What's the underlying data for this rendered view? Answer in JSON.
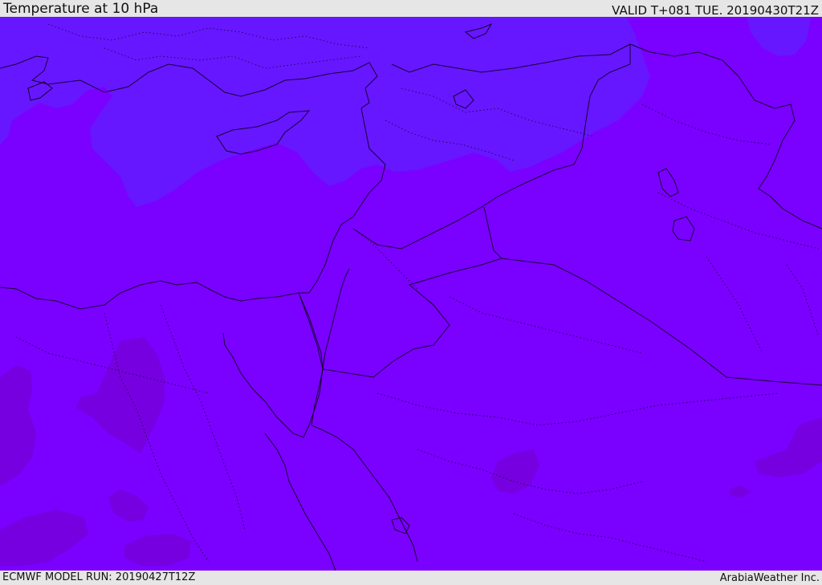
{
  "header": {
    "title": "Temperature at 10 hPa",
    "valid": "VALID T+081 TUE. 20190430T21Z"
  },
  "footer": {
    "model_run": "ECMWF MODEL RUN: 20190427T12Z",
    "credit": "ArabiaWeather Inc."
  },
  "map": {
    "background_color": "#7a00ff",
    "cool_region_color": "#6617ff",
    "warm_region_color": "#7600e0",
    "boundary_color": "#1a0033"
  }
}
